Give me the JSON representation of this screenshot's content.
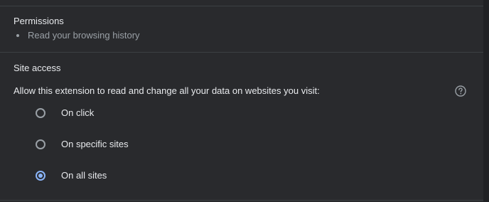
{
  "permissions": {
    "title": "Permissions",
    "items": [
      "Read your browsing history"
    ]
  },
  "site_access": {
    "title": "Site access",
    "description": "Allow this extension to read and change all your data on websites you visit:",
    "help_icon": "help-circle-icon",
    "options": [
      {
        "label": "On click",
        "selected": false
      },
      {
        "label": "On specific sites",
        "selected": false
      },
      {
        "label": "On all sites",
        "selected": true
      }
    ]
  },
  "colors": {
    "background": "#292a2d",
    "divider": "#3c4043",
    "text_primary": "#e8eaed",
    "text_secondary": "#9aa0a6",
    "accent": "#8ab4f8"
  }
}
